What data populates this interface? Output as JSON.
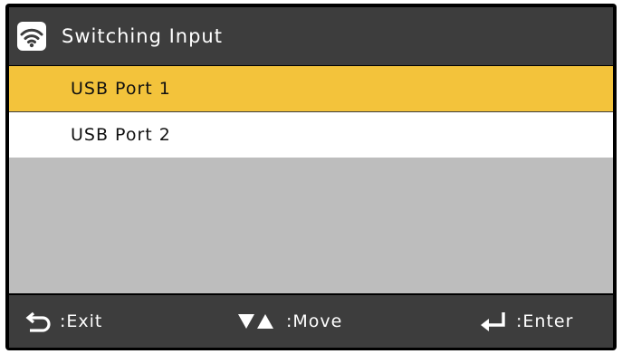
{
  "header": {
    "title": "Switching Input",
    "icon": "wifi-icon"
  },
  "list": {
    "items": [
      {
        "label": "USB Port 1",
        "state": "selected"
      },
      {
        "label": "USB Port 2",
        "state": "normal"
      },
      {
        "label": "",
        "state": "empty"
      },
      {
        "label": "",
        "state": "empty"
      },
      {
        "label": "",
        "state": "empty"
      }
    ]
  },
  "footer": {
    "exit_label": ":Exit",
    "move_label": ":Move",
    "enter_label": ":Enter",
    "exit_icon": "back-arrow-icon",
    "move_icon": "down-up-triangles-icon",
    "enter_icon": "enter-return-icon"
  },
  "colors": {
    "selected": "#f3c33b",
    "background": "#3d3d3d",
    "empty_row": "#bdbdbd"
  }
}
